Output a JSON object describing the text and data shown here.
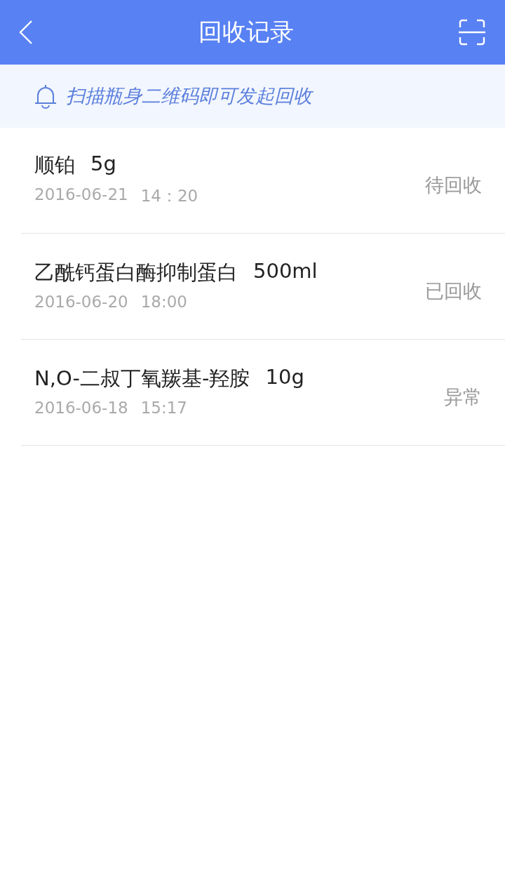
{
  "header": {
    "title": "回收记录"
  },
  "notice": {
    "text": "扫描瓶身二维码即可发起回收"
  },
  "records": [
    {
      "name": "顺铂",
      "amount": "5g",
      "date": "2016-06-21",
      "time": "14：20",
      "status": "待回收"
    },
    {
      "name": "乙酰钙蛋白酶抑制蛋白",
      "amount": "500ml",
      "date": "2016-06-20",
      "time": "18:00",
      "status": "已回收"
    },
    {
      "name": "N,O-二叔丁氧羰基-羟胺",
      "amount": "10g",
      "date": "2016-06-18",
      "time": "15:17",
      "status": "异常"
    }
  ]
}
